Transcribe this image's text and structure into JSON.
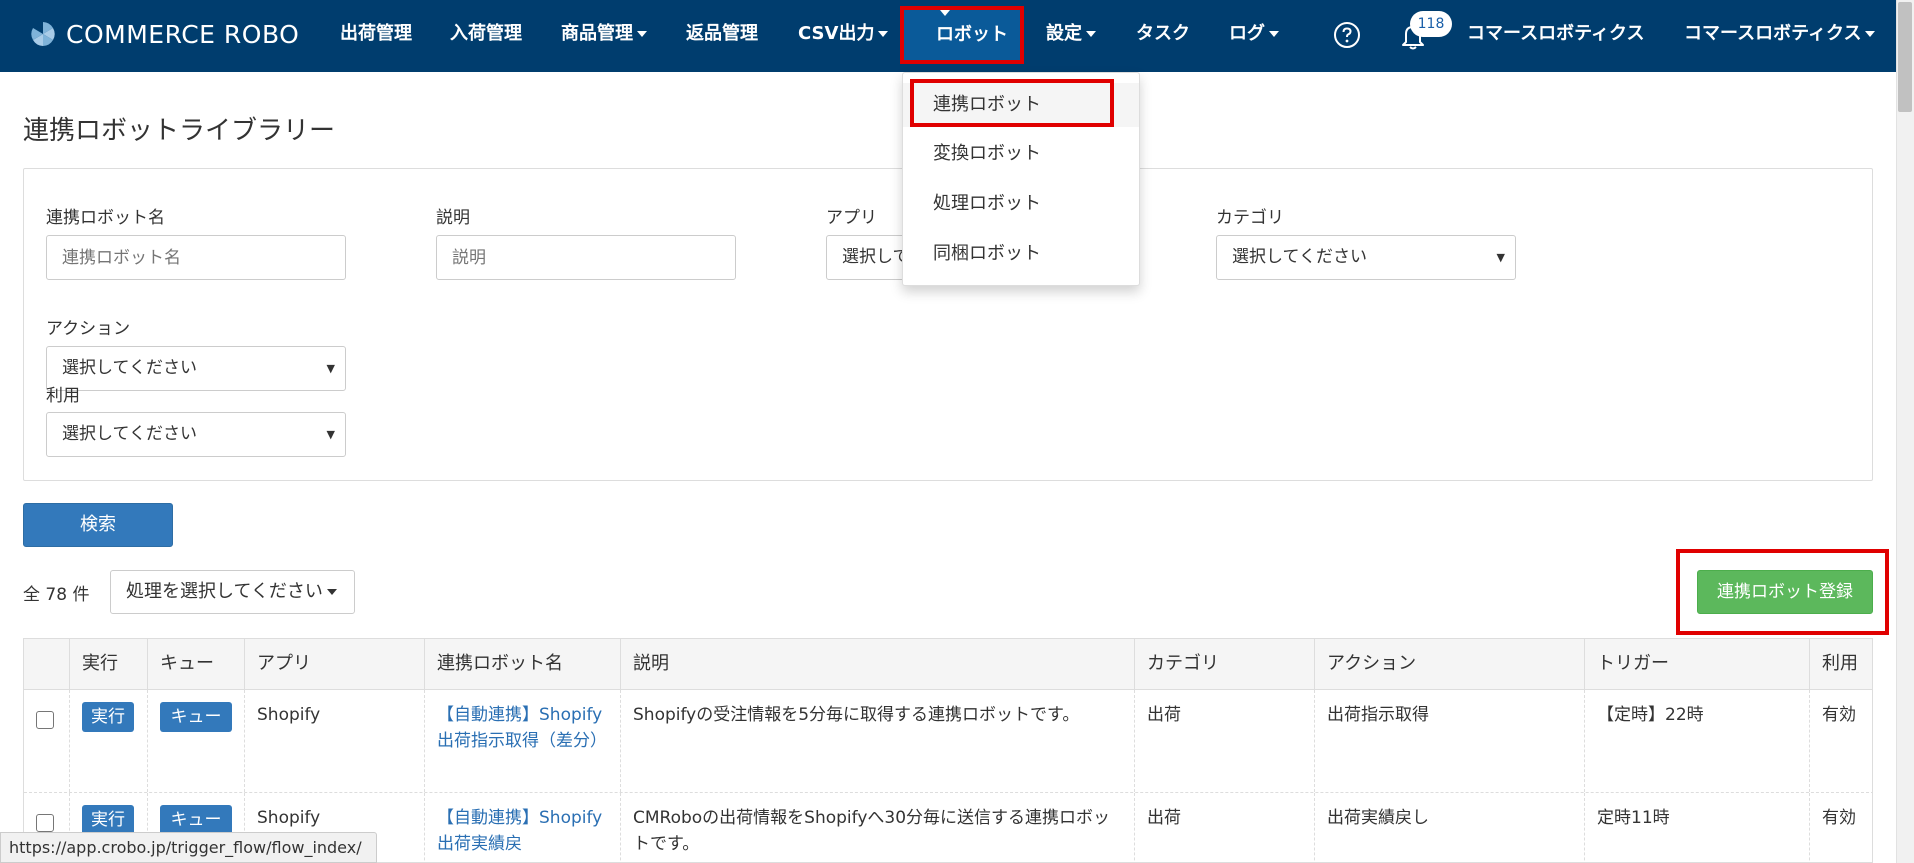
{
  "nav": {
    "logo_text": "COMMERCE ROBO",
    "items": [
      {
        "label": "出荷管理",
        "dropdown": false
      },
      {
        "label": "入荷管理",
        "dropdown": false
      },
      {
        "label": "商品管理",
        "dropdown": true
      },
      {
        "label": "返品管理",
        "dropdown": false
      },
      {
        "label": "CSV出力",
        "dropdown": true
      },
      {
        "label": "ロボット",
        "dropdown": true
      },
      {
        "label": "設定",
        "dropdown": true
      },
      {
        "label": "タスク",
        "dropdown": false
      },
      {
        "label": "ログ",
        "dropdown": true
      }
    ],
    "notification_count": "118",
    "company_name": "コマースロボティクス",
    "user_menu": "コマースロボティクス",
    "colors": {
      "bar": "#003d6e",
      "highlight": "#e00000"
    }
  },
  "robot_menu": {
    "items": [
      "連携ロボット",
      "変換ロボット",
      "処理ロボット",
      "同梱ロボット"
    ]
  },
  "page": {
    "title": "連携ロボットライブラリー"
  },
  "filters": {
    "name_label": "連携ロボット名",
    "name_placeholder": "連携ロボット名",
    "description_label": "説明",
    "description_placeholder": "説明",
    "app_label": "アプリ",
    "app_value": "選択してください",
    "category_label": "カテゴリ",
    "category_value": "選択してください",
    "action_label": "アクション",
    "action_value": "選択してください",
    "usage_label": "利用",
    "usage_value": "選択してください"
  },
  "search_button": "検索",
  "list": {
    "total": "全 78 件",
    "bulk_action": "処理を選択してください",
    "register_button": "連携ロボット登録"
  },
  "table": {
    "headers": [
      "実行",
      "キュー",
      "アプリ",
      "連携ロボット名",
      "説明",
      "カテゴリ",
      "アクション",
      "トリガー",
      "利用"
    ],
    "exec_label": "実行",
    "queue_label": "キュー",
    "rows": [
      {
        "app": "Shopify",
        "name": "【自動連携】Shopify 出荷指示取得（差分）",
        "description": "Shopifyの受注情報を5分毎に取得する連携ロボットです。",
        "category": "出荷",
        "action": "出荷指示取得",
        "trigger": "【定時】22時",
        "usage": "有効"
      },
      {
        "app": "Shopify",
        "name": "【自動連携】Shopify 出荷実績戻",
        "description": "CMRoboの出荷情報をShopifyへ30分毎に送信する連携ロボットです。",
        "category": "出荷",
        "action": "出荷実績戻し",
        "trigger": "定時11時",
        "usage": "有効"
      }
    ]
  },
  "status_url": "https://app.crobo.jp/trigger_flow/flow_index/"
}
